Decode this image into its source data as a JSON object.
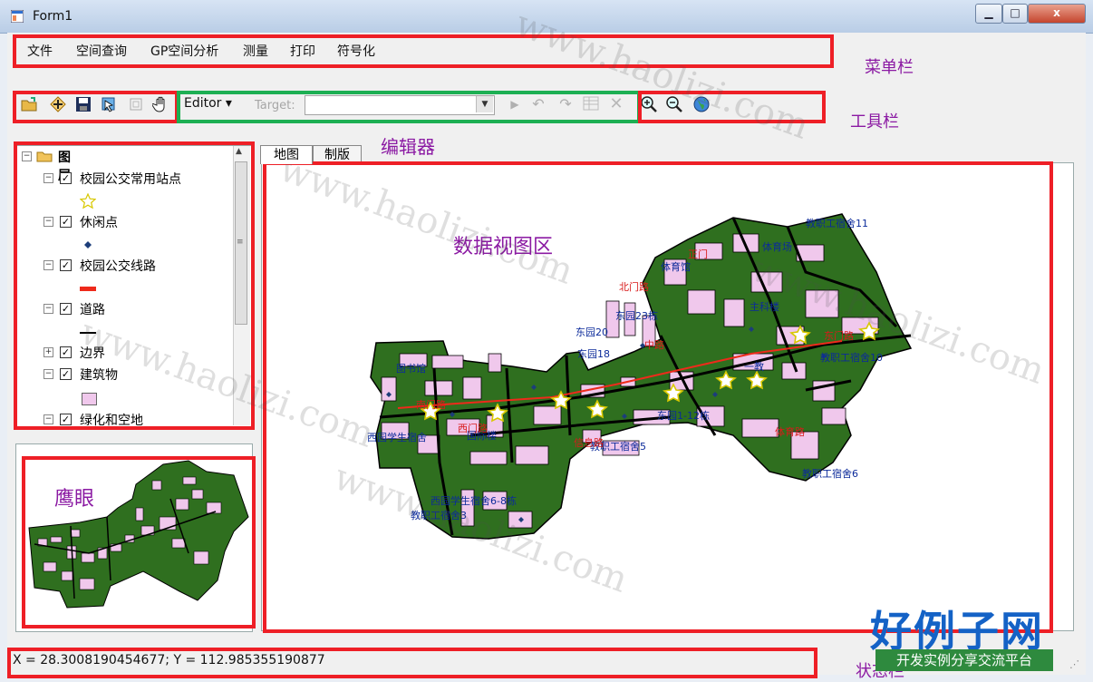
{
  "window": {
    "title": "Form1",
    "minimize_glyph": "▁",
    "maximize_glyph": "□",
    "close_glyph": "x"
  },
  "menu": {
    "items": [
      "文件",
      "空间查询",
      "GP空间分析",
      "测量",
      "打印",
      "符号化"
    ]
  },
  "toolbar": {
    "editor_label": "Editor",
    "editor_dropdown_glyph": "▾",
    "target_label": "Target:",
    "icons": [
      "open-folder-icon",
      "add-data-icon",
      "save-icon",
      "select-feature-icon",
      "identify-icon",
      "pan-hand-icon",
      "zoom-in-icon",
      "zoom-out-icon",
      "full-extent-globe-icon"
    ],
    "editor_icons": [
      "sketch-tool-icon",
      "undo-icon",
      "redo-icon",
      "attributes-icon",
      "delete-icon"
    ]
  },
  "annotations": {
    "menubar": "菜单栏",
    "toolbar": "工具栏",
    "editor": "编辑器",
    "data_view": "数据视图区",
    "eagle_eye": "鹰眼",
    "statusbar": "状态栏"
  },
  "toc": {
    "root_label": "图层",
    "layers": [
      {
        "name": "校园公交常用站点",
        "symbol": "star",
        "expanded": true
      },
      {
        "name": "休闲点",
        "symbol": "diamond",
        "expanded": true
      },
      {
        "name": "校园公交线路",
        "symbol": "red-line",
        "expanded": true
      },
      {
        "name": "道路",
        "symbol": "black-line",
        "expanded": true
      },
      {
        "name": "边界",
        "symbol": "none",
        "expanded": false
      },
      {
        "name": "建筑物",
        "symbol": "pink-fill",
        "expanded": true
      },
      {
        "name": "绿化和空地",
        "symbol": "none",
        "expanded": true
      }
    ]
  },
  "tabs": [
    {
      "label": "地图"
    },
    {
      "label": "制版"
    }
  ],
  "map_labels": {
    "blue": [
      "教职工宿舍11",
      "体育馆",
      "体育场",
      "主科楼",
      "东园23栋",
      "东园20",
      "东园18",
      "一教",
      "教职工宿舍10",
      "东园1-12栋",
      "西园学生宿舍",
      "国际楼",
      "西园学生宿舍6-8栋",
      "教职工宿舍3",
      "教职工宿舍5",
      "教职工宿舍6",
      "图书馆"
    ],
    "red": [
      "南门路",
      "东门路",
      "北门路",
      "中路",
      "西门路",
      "正门",
      "体育路",
      "信息路"
    ]
  },
  "status": {
    "coords": "X = 28.3008190454677;  Y = 112.985355190877"
  },
  "branding": {
    "logo": "好例子网",
    "tagline": "开发实例分享交流平台",
    "watermark": "www.haolizi.com"
  },
  "colors": {
    "annotation_red": "#ee1f26",
    "annotation_green": "#1daf53",
    "annotation_text": "#8b1aa3",
    "map_green": "#2f6f1f",
    "building_pink": "#f0c8ec"
  }
}
